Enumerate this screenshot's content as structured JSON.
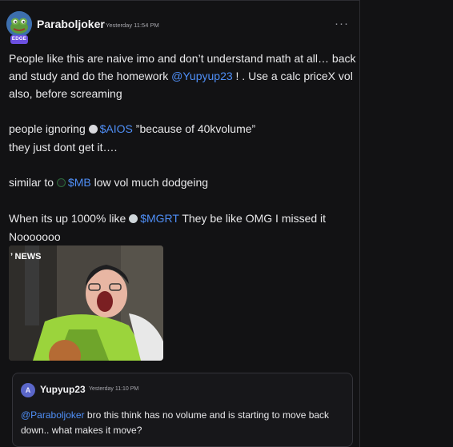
{
  "post": {
    "author": "Paraboljoker",
    "badge": "EDGE",
    "timestamp": "Yesterday 11:54 PM",
    "more_label": "···",
    "line1": "People like this are naive imo and don’t understand math at all… back",
    "line2_pre": "and study and do the homework ",
    "line2_mention": "@Yupyup23",
    "line2_post": " ! . Use a calc priceX vol",
    "line3": "also, before screaming",
    "line4_pre": "people ignoring ",
    "line4_ticker": "$AIOS",
    "line4_post": " ”because of 40kvolume”",
    "line5": "they just dont get it….",
    "line6_pre": "similar to ",
    "line6_ticker": "$MB",
    "line6_post": " low vol much dodgeing",
    "line7_pre": "When its up 1000% like ",
    "line7_ticker": "$MGRT",
    "line7_post": " They be like OMG I missed it",
    "line8": "Nooooooo",
    "gif_caption": "’ NEWS"
  },
  "quote": {
    "avatar_letter": "A",
    "author": "Yupyup23",
    "timestamp": "Yesterday 11:10 PM",
    "mention": "@Paraboljoker",
    "line1_post": " bro this think has no volume and is starting to move back",
    "line2": "down.. what makes it move?"
  },
  "colors": {
    "background": "#121214",
    "link": "#4f8ff7",
    "badge": "#6b4fe0"
  }
}
